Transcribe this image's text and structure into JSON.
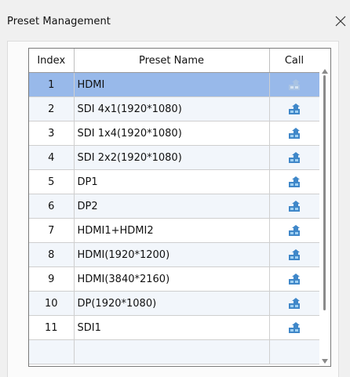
{
  "window": {
    "title": "Preset Management"
  },
  "table": {
    "columns": [
      "Index",
      "Preset Name",
      "Call"
    ],
    "rows": [
      {
        "index": "1",
        "name": "HDMI"
      },
      {
        "index": "2",
        "name": "SDI 4x1(1920*1080)"
      },
      {
        "index": "3",
        "name": "SDI 1x4(1920*1080)"
      },
      {
        "index": "4",
        "name": "SDI 2x2(1920*1080)"
      },
      {
        "index": "5",
        "name": "DP1"
      },
      {
        "index": "6",
        "name": "DP2"
      },
      {
        "index": "7",
        "name": "HDMI1+HDMI2"
      },
      {
        "index": "8",
        "name": "HDMI(1920*1200)"
      },
      {
        "index": "9",
        "name": "HDMI(3840*2160)"
      },
      {
        "index": "10",
        "name": "DP(1920*1080)"
      },
      {
        "index": "11",
        "name": "SDI1"
      }
    ],
    "selected_row": 1,
    "call_icon": "call-preset-icon",
    "colors": {
      "selection": "#98b9ea",
      "alt_row": "#f2f6fb",
      "icon_blue": "#3f87c9"
    }
  }
}
